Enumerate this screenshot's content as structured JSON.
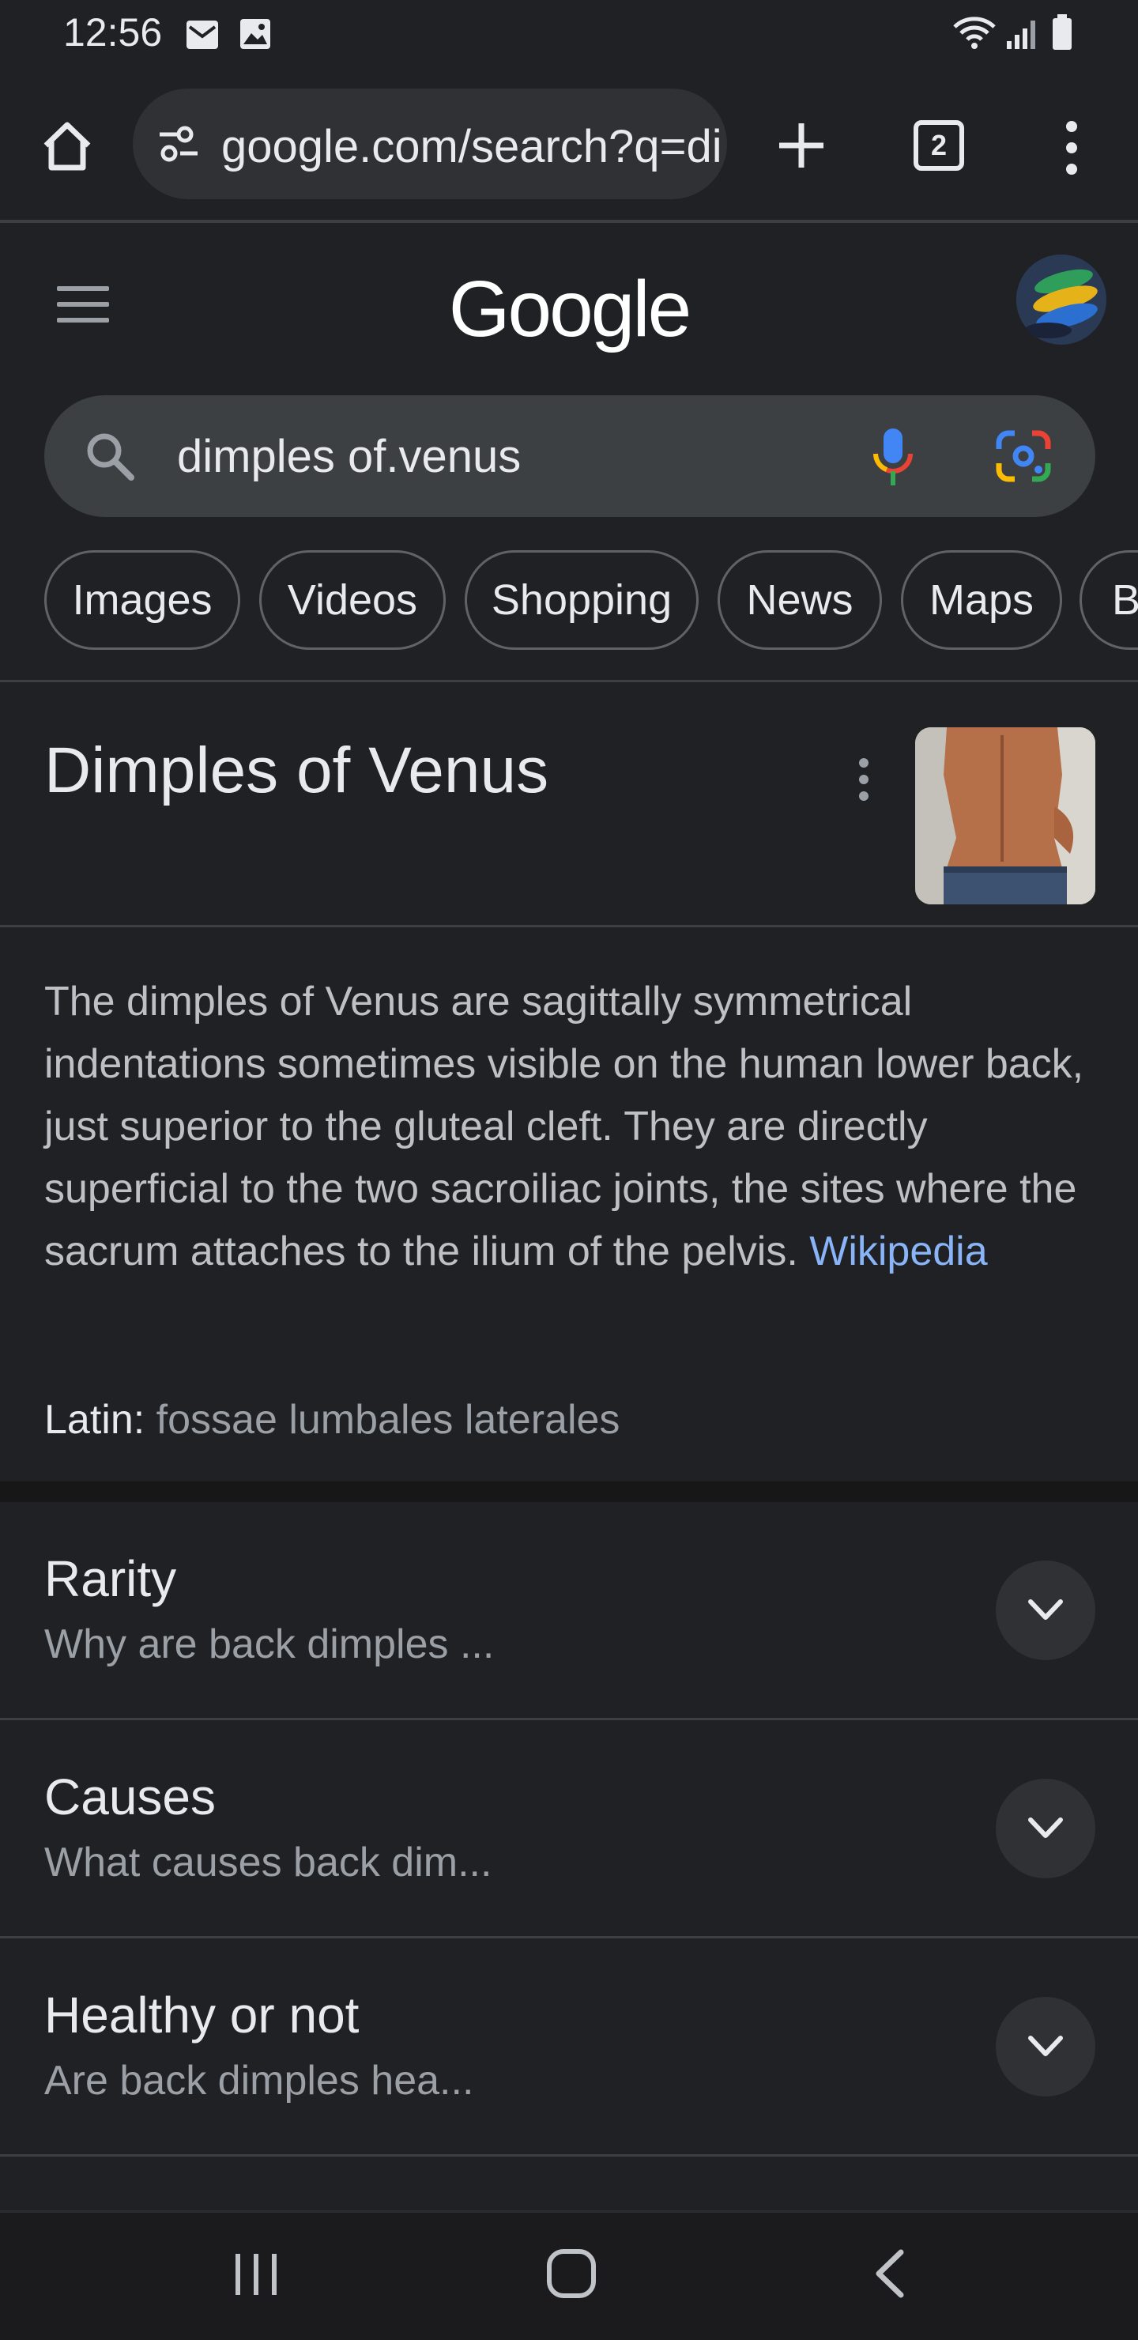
{
  "status_bar": {
    "time": "12:56"
  },
  "browser": {
    "url": "google.com/search?q=dimples+of.venus",
    "tab_count": "2"
  },
  "google": {
    "logo": "Google"
  },
  "search": {
    "query": "dimples of.venus"
  },
  "chips": [
    "Images",
    "Videos",
    "Shopping",
    "News",
    "Maps",
    "Books"
  ],
  "knowledge_panel": {
    "title": "Dimples of Venus",
    "description": "The dimples of Venus are sagittally symmetrical indentations sometimes visible on the human lower back, just superior to the gluteal cleft. They are directly superficial to the two sacroiliac joints, the sites where the sacrum attaches to the ilium of the pelvis.",
    "source": "Wikipedia",
    "latin_label": "Latin:",
    "latin_value": "fossae lumbales laterales"
  },
  "accordions": [
    {
      "title": "Rarity",
      "subtitle": "Why are back dimples ..."
    },
    {
      "title": "Causes",
      "subtitle": "What causes back dim..."
    },
    {
      "title": "Healthy or not",
      "subtitle": "Are back dimples hea..."
    }
  ],
  "colors": {
    "background": "#202124",
    "link": "#8ab4f8",
    "mic_blue": "#4285f4",
    "mic_red": "#ea4335",
    "mic_yellow": "#fbbc04",
    "mic_green": "#34a853"
  }
}
